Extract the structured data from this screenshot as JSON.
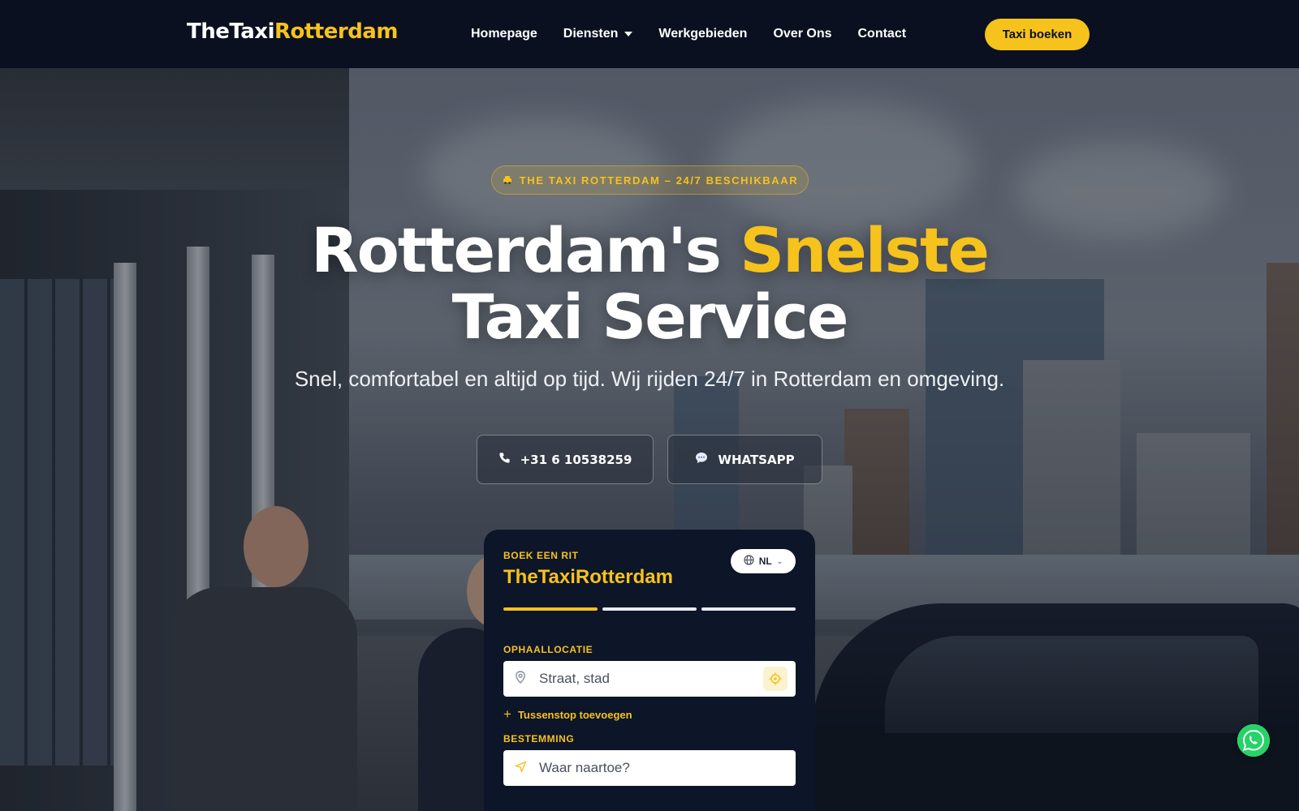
{
  "nav": {
    "logo_part1": "TheTaxi",
    "logo_part2": "Rotterdam",
    "links": [
      {
        "label": "Homepage"
      },
      {
        "label": "Diensten",
        "has_dropdown": true
      },
      {
        "label": "Werkgebieden"
      },
      {
        "label": "Over Ons"
      },
      {
        "label": "Contact"
      }
    ],
    "cta_label": "Taxi boeken"
  },
  "hero": {
    "badge_icon": "taxi-icon",
    "badge_text": "THE TAXI ROTTERDAM – 24/7 BESCHIKBAAR",
    "headline_part1": "Rotterdam's ",
    "headline_accent": "Snelste",
    "headline_line2": "Taxi Service",
    "subline": "Snel, comfortabel en altijd op tijd. Wij rijden 24/7 in Rotterdam en omgeving.",
    "phone_button": {
      "icon": "phone-icon",
      "label": "+31 6 10538259"
    },
    "whatsapp_button": {
      "icon": "chat-bubble-icon",
      "label": "WHATSAPP"
    }
  },
  "booking": {
    "kicker": "BOEK EEN RIT",
    "title": "TheTaxiRotterdam",
    "language": "NL",
    "steps": [
      {
        "active": true
      },
      {
        "active": false
      },
      {
        "active": false
      }
    ],
    "pickup_label": "OPHAALLOCATIE",
    "pickup_placeholder": "Straat, stad",
    "add_stop_label": "Tussenstop toevoegen",
    "destination_label": "BESTEMMING",
    "destination_placeholder": "Waar naartoe?"
  },
  "colors": {
    "accent": "#f6c21c",
    "nav_bg": "#0a1020",
    "card_bg": "#0d1528",
    "whatsapp": "#25d366"
  }
}
